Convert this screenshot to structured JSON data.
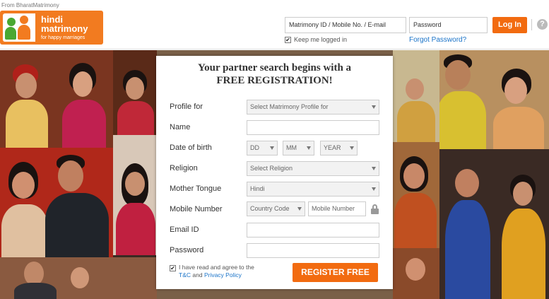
{
  "header": {
    "from_text": "From BharatMatrimony",
    "logo_line1": "hindi",
    "logo_line2": "matrimony",
    "logo_tagline": "for happy marriages",
    "login_id_placeholder": "Matrimony ID / Mobile No. / E-mail",
    "password_placeholder": "Password",
    "login_button": "Log In",
    "help_icon_glyph": "?",
    "keep_logged_in": "Keep me logged in",
    "forgot_password": "Forgot Password?",
    "keep_logged_in_checked": true
  },
  "registration": {
    "title_line1": "Your partner search begins with a",
    "title_line2": "FREE REGISTRATION!",
    "rows": [
      {
        "label": "Profile for",
        "placeholder": "Select Matrimony Profile for"
      },
      {
        "label": "Name",
        "placeholder": ""
      },
      {
        "label": "Date of birth",
        "day": "DD",
        "month": "MM",
        "year": "YEAR"
      },
      {
        "label": "Religion",
        "placeholder": "Select Religion"
      },
      {
        "label": "Mother Tongue",
        "value": "Hindi"
      },
      {
        "label": "Mobile Number",
        "country_code": "Country Code",
        "mobile_placeholder": "Mobile Number"
      },
      {
        "label": "Email ID",
        "placeholder": ""
      },
      {
        "label": "Password",
        "placeholder": ""
      }
    ],
    "agree_prefix": "I have read and agree to the",
    "tc_link": "T&C",
    "agree_and": "and",
    "privacy_link": "Privacy Policy",
    "agree_checked": true,
    "register_button": "REGISTER FREE"
  },
  "colors": {
    "brand_orange": "#f26b10",
    "logo_orange": "#f27b20",
    "logo_green": "#4aa832",
    "link_blue": "#1a73c8"
  }
}
